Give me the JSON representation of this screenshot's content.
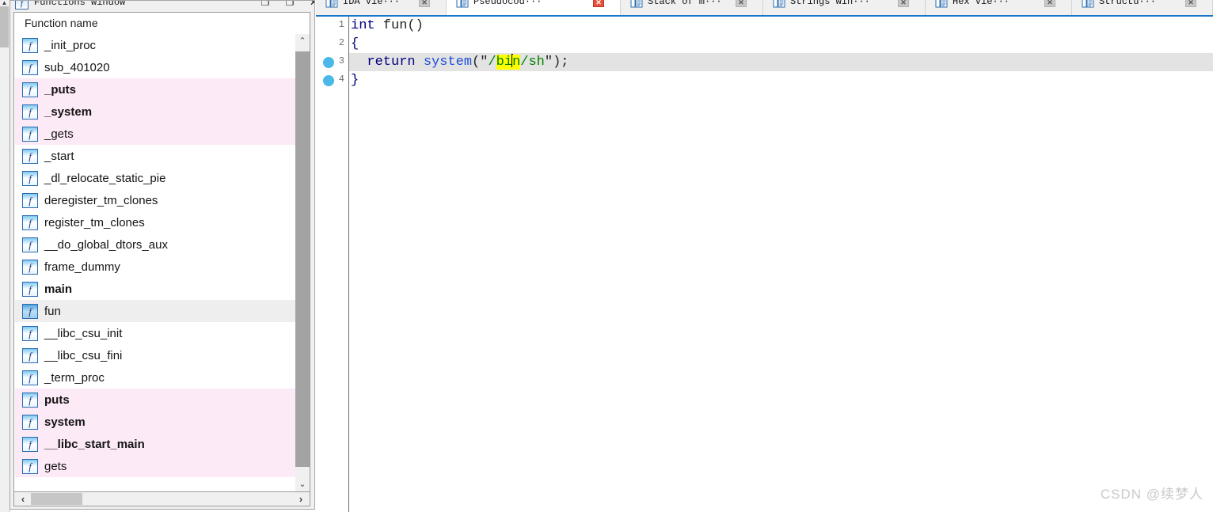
{
  "functions_window": {
    "title": "Functions window",
    "title_icon": "function-f-icon",
    "window_buttons": {
      "maximize": "❐",
      "restore": "❐",
      "close": "✕"
    },
    "column_header": "Function name",
    "rows": [
      {
        "label": "_init_proc",
        "bold": false,
        "highlight": "none",
        "selected": false
      },
      {
        "label": "sub_401020",
        "bold": false,
        "highlight": "none",
        "selected": false
      },
      {
        "label": "_puts",
        "bold": true,
        "highlight": "import",
        "selected": false
      },
      {
        "label": "_system",
        "bold": true,
        "highlight": "import",
        "selected": false
      },
      {
        "label": "_gets",
        "bold": false,
        "highlight": "import",
        "selected": false
      },
      {
        "label": "_start",
        "bold": false,
        "highlight": "none",
        "selected": false
      },
      {
        "label": "_dl_relocate_static_pie",
        "bold": false,
        "highlight": "none",
        "selected": false
      },
      {
        "label": "deregister_tm_clones",
        "bold": false,
        "highlight": "none",
        "selected": false
      },
      {
        "label": "register_tm_clones",
        "bold": false,
        "highlight": "none",
        "selected": false
      },
      {
        "label": "__do_global_dtors_aux",
        "bold": false,
        "highlight": "none",
        "selected": false
      },
      {
        "label": "frame_dummy",
        "bold": false,
        "highlight": "none",
        "selected": false
      },
      {
        "label": "main",
        "bold": true,
        "highlight": "none",
        "selected": false
      },
      {
        "label": "fun",
        "bold": false,
        "highlight": "none",
        "selected": true
      },
      {
        "label": "__libc_csu_init",
        "bold": false,
        "highlight": "none",
        "selected": false
      },
      {
        "label": "__libc_csu_fini",
        "bold": false,
        "highlight": "none",
        "selected": false
      },
      {
        "label": "_term_proc",
        "bold": false,
        "highlight": "none",
        "selected": false
      },
      {
        "label": "puts",
        "bold": true,
        "highlight": "import",
        "selected": false
      },
      {
        "label": "system",
        "bold": true,
        "highlight": "import",
        "selected": false
      },
      {
        "label": "__libc_start_main",
        "bold": true,
        "highlight": "import",
        "selected": false
      },
      {
        "label": "gets",
        "bold": false,
        "highlight": "import",
        "selected": false
      }
    ],
    "scrollbars": {
      "vertical_up": "⌃",
      "vertical_down": "⌄",
      "horizontal_left": "‹",
      "horizontal_right": "›"
    }
  },
  "tabs": [
    {
      "label": "IDA Vie···",
      "icon": "ida-view-icon",
      "active": false,
      "close_red": false
    },
    {
      "label": "Pseudocod···",
      "icon": "pseudocode-icon",
      "active": true,
      "close_red": true
    },
    {
      "label": "Stack of m···",
      "icon": "stack-icon",
      "active": false,
      "close_red": false
    },
    {
      "label": "Strings win···",
      "icon": "strings-icon",
      "active": false,
      "close_red": false
    },
    {
      "label": "Hex Vie···",
      "icon": "hex-view-icon",
      "active": false,
      "close_red": false
    },
    {
      "label": "Structu···",
      "icon": "structures-icon",
      "active": false,
      "close_red": false
    }
  ],
  "code": {
    "lines": [
      {
        "number": "1",
        "breakpoint": false,
        "current": false
      },
      {
        "number": "2",
        "breakpoint": false,
        "current": false
      },
      {
        "number": "3",
        "breakpoint": true,
        "current": true
      },
      {
        "number": "4",
        "breakpoint": true,
        "current": false
      }
    ],
    "line1_keyword": "int",
    "line1_name": " fun()",
    "line2": "{",
    "line3_indent": "  ",
    "line3_return": "return",
    "line3_space": " ",
    "line3_call": "system",
    "line3_open": "(\"",
    "line3_str_pre": "/",
    "line3_str_hl_a": "bi",
    "line3_str_hl_b": "n",
    "line3_str_post": "/sh",
    "line3_close": "\");",
    "line4": "}"
  },
  "watermark": "CSDN @续梦人",
  "colors": {
    "import_row": "#fdeaf7",
    "selected_row": "#eeeeee",
    "current_line": "#e3e3e3",
    "highlight": "#ffff00",
    "string": "#008000",
    "keyword": "#00007f",
    "function": "#1f4fd8",
    "breakpoint": "#4bb8ea",
    "active_tab_underline": "#1976c8"
  }
}
